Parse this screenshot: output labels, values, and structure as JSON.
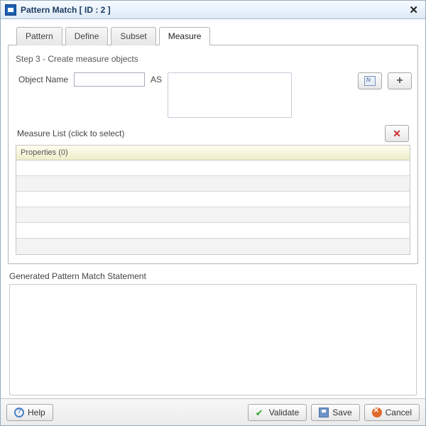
{
  "window": {
    "title": "Pattern Match [ ID : 2 ]"
  },
  "tabs": {
    "pattern": "Pattern",
    "define": "Define",
    "subset": "Subset",
    "measure": "Measure",
    "active": "measure"
  },
  "measure": {
    "step_title": "Step 3 - Create measure objects",
    "object_name_label": "Object Name",
    "object_name_value": "",
    "as_label": "AS",
    "as_value": "",
    "list_label": "Measure List (click to select)",
    "grid_header": "Properties (0)",
    "rows": [
      "",
      "",
      "",
      "",
      "",
      ""
    ]
  },
  "generated": {
    "label": "Generated Pattern Match Statement",
    "value": ""
  },
  "footer": {
    "help": "Help",
    "validate": "Validate",
    "save": "Save",
    "cancel": "Cancel"
  }
}
